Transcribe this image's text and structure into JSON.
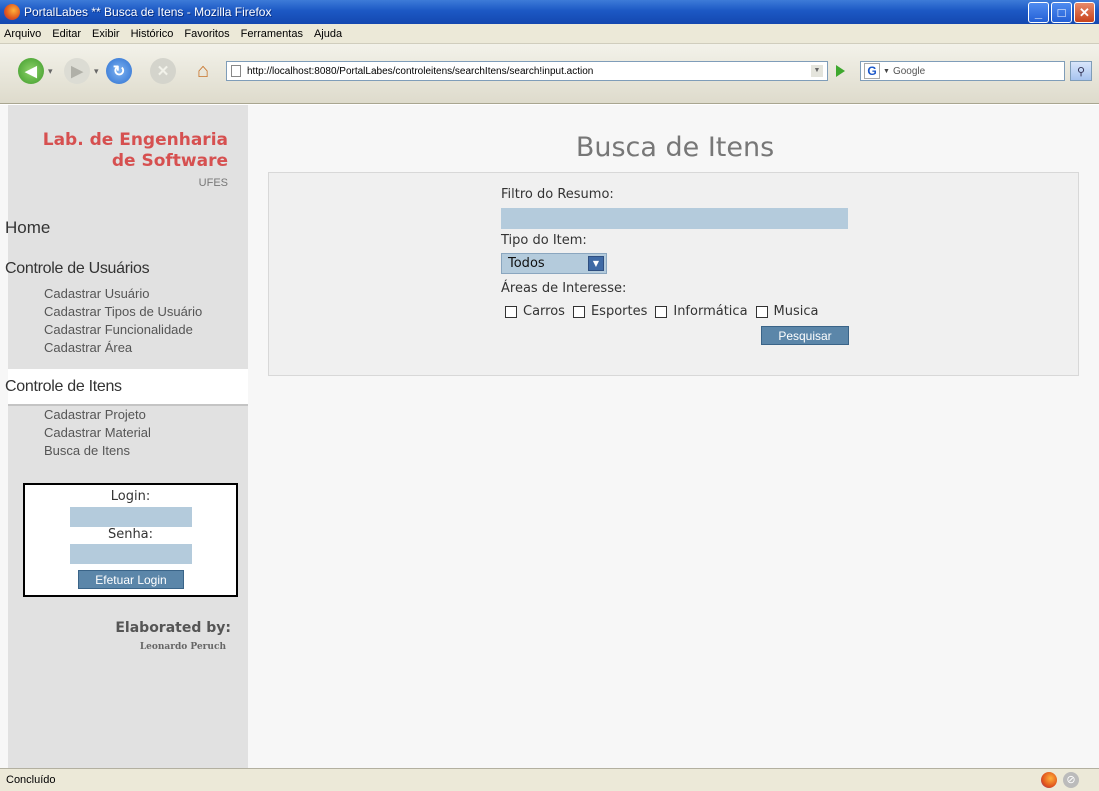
{
  "window": {
    "title": "PortalLabes ** Busca de Itens - Mozilla Firefox"
  },
  "menu": [
    "Arquivo",
    "Editar",
    "Exibir",
    "Histórico",
    "Favoritos",
    "Ferramentas",
    "Ajuda"
  ],
  "toolbar": {
    "url": "http://localhost:8080/PortalLabes/controleitens/searchItens/search!input.action",
    "search_placeholder": "Google"
  },
  "sidebar": {
    "title_line1": "Lab. de Engenharia",
    "title_line2": "de Software",
    "subtitle": "UFES",
    "home": "Home",
    "section1": {
      "title": "Controle de Usuários",
      "links": [
        "Cadastrar Usuário",
        "Cadastrar Tipos de Usuário",
        "Cadastrar Funcionalidade",
        "Cadastrar Área"
      ]
    },
    "section2": {
      "title": "Controle de Itens",
      "links": [
        "Cadastrar Projeto",
        "Cadastrar Material",
        "Busca de Itens"
      ]
    },
    "login": {
      "login_label": "Login:",
      "password_label": "Senha:",
      "button": "Efetuar Login"
    },
    "credit_label": "Elaborated by:",
    "credit_name": "Leonardo Peruch"
  },
  "main": {
    "title": "Busca de Itens",
    "filter_label": "Filtro do Resumo:",
    "filter_value": "",
    "type_label": "Tipo do Item:",
    "type_selected": "Todos",
    "areas_label": "Áreas de Interesse:",
    "areas": [
      "Carros",
      "Esportes",
      "Informática",
      "Musica"
    ],
    "search_button": "Pesquisar"
  },
  "status": {
    "text": "Concluído"
  },
  "colors": {
    "accent": "#d65050",
    "button": "#5b86a9",
    "input": "#b4cbdc"
  }
}
